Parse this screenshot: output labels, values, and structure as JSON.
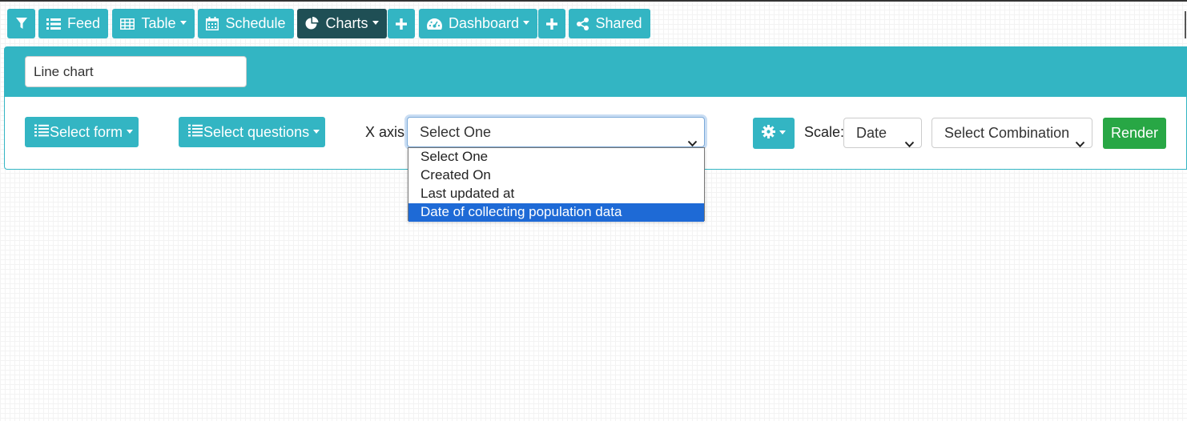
{
  "toolbar": {
    "feed_label": "Feed",
    "table_label": "Table",
    "schedule_label": "Schedule",
    "charts_label": "Charts",
    "dashboard_label": "Dashboard",
    "shared_label": "Shared",
    "icons": [
      "filter-icon",
      "list-icon",
      "table-icon",
      "calendar-icon",
      "pie-chart-icon",
      "plus-icon",
      "dashboard-icon",
      "plus-icon",
      "share-icon"
    ]
  },
  "chart_panel": {
    "chart_name_value": "Line chart",
    "select_form_label": "Select form",
    "select_questions_label": "Select questions",
    "x_axis_label": "X axis:",
    "x_axis_value": "Select One",
    "x_axis_options": [
      "Select One",
      "Created On",
      "Last updated at",
      "Date of collecting population data"
    ],
    "x_axis_highlighted": "Date of collecting population data",
    "scale_label": "Scale:",
    "scale_value": "Date",
    "combination_value": "Select Combination",
    "render_label": "Render"
  },
  "colors": {
    "accent": "#33b5c3",
    "active_tab": "#1f4f55",
    "render": "#28a745",
    "option_highlight": "#1e6ad6"
  }
}
